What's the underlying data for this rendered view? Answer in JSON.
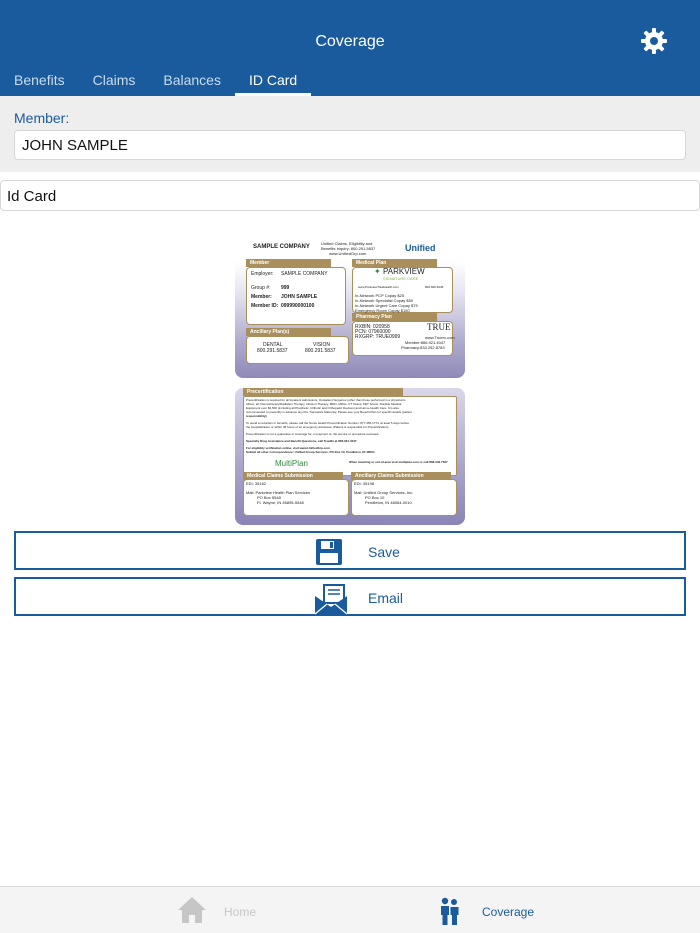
{
  "header": {
    "title": "Coverage",
    "settings_icon": "gear-icon"
  },
  "tabs": [
    {
      "label": "Benefits",
      "active": false
    },
    {
      "label": "Claims",
      "active": false
    },
    {
      "label": "Balances",
      "active": false
    },
    {
      "label": "ID Card",
      "active": true
    }
  ],
  "member": {
    "label": "Member:",
    "value": "JOHN SAMPLE"
  },
  "document": {
    "value": "Id Card"
  },
  "card_front": {
    "company": "SAMPLE COMPANY",
    "claims_title": "Unified Claims, Eligibility and Benefits Inquiry: 800.291.5837",
    "claims_site": "www.UnifiedGrp.com",
    "logo": "Unified",
    "member_tab": "Member",
    "employer_label": "Employer:",
    "employer_value": "SAMPLE COMPANY",
    "group_label": "Group #:",
    "group_value": "999",
    "member_label": "Member:",
    "member_value": "JOHN SAMPLE",
    "member_id_label": "Member ID:",
    "member_id_value": "099990000100",
    "ancillary_tab": "Ancillary Plan(s)",
    "dental_label": "DENTAL",
    "dental_phone": "800.291.5837",
    "vision_label": "VISION",
    "vision_phone": "800.291.5837",
    "medical_tab": "Medical Plan",
    "parkview": "PARKVIEW",
    "signature_care": "SIGNATURE CARE",
    "medical_site": "www.ParkviewTotalHealth.com",
    "medical_phone": "800.696.4648",
    "copay_1": "In-Network PCP Copay $25",
    "copay_2": "In-Network Specialist Copay $50",
    "copay_3": "In-Network Urgent Care Copay $75",
    "copay_4": "Emergency Room Copay $150",
    "pharmacy_tab": "Pharmacy Plan",
    "rxbin": "RXBIN: 020958",
    "pcn": "PCN: 07960000",
    "rxgrp": "RXGRP: TRUE0999",
    "true_logo": "TRUE",
    "true_site": "www.Truerx.com",
    "member_phone": "Member:866.921.4047",
    "pharmacy_phone": "Pharmacy:833.252.8783"
  },
  "card_back": {
    "precert_tab": "Precertification",
    "precert_text_1": "Precertification is required for all Inpatient Admissions, Outpatient Surgeries (other than those performed in a physician's",
    "precert_text_2": "office), all Chemotherapy/Radiation Therapy, Infusion Therapy, MRIs, MRAs, CT Scans, PET Scans, Durable Medical",
    "precert_text_3": "Equipment over $2,500 (including all Prosthetic, Orthotic and Orthopedic Devices) and Home Health Care. It is also",
    "precert_text_4": "recommended to precertify in advance any Pre-Transplant Maternity. Please see your Benefit Plan for specific details (patient",
    "precert_text_5": "responsibility).",
    "precert_text_6": "To avoid a reduction in benefits, please call the Nurse Health Precertification Number: 877.456.1774, at least 5 days before",
    "precert_text_7": "the hospitalization or within 48 hours of an emergency admission (Patient is responsible for Precertification).",
    "precert_text_8": "Precertification is not a guarantee of coverage for, or payment of, the service or procedure reviewed.",
    "specialty": "Specialty Drug Assistance and Benefit Questions, call TrueRx at 866.921.4047",
    "eligibility_1": "For eligibility verification online, visit www.UnifiedGrp.com",
    "eligibility_2": "Submit all other correspondence: Unified Group Services, PO Box 10, Pendleton, IN 46064",
    "multiplan": "MultiPlan",
    "travel": "When traveling or out-of-area visit multiplan.com or call 866.342.7527",
    "medical_claims_tab": "Medical Claims Submission",
    "edi_1": "EDI: 35162",
    "mail_1a": "Mail: Parkview Health Plan Services",
    "mail_1b": "PO Box 5548",
    "mail_1c": "Ft. Wayne, IN 46895-5548",
    "ancillary_claims_tab": "Ancillary Claims Submission",
    "edi_2": "EDI: 35198",
    "mail_2a": "Mail: Unified Group Services, Inc.",
    "mail_2b": "PO Box 10",
    "mail_2c": "Pendleton, IN 46064-0010"
  },
  "actions": {
    "save": "Save",
    "email": "Email"
  },
  "bottom_nav": [
    {
      "label": "Home",
      "icon": "home-icon",
      "active": false
    },
    {
      "label": "Coverage",
      "icon": "family-icon",
      "active": true
    }
  ],
  "colors": {
    "brand": "#1a5b9d",
    "card_accent": "#a98f5c",
    "inactive": "#c6c6c6"
  }
}
